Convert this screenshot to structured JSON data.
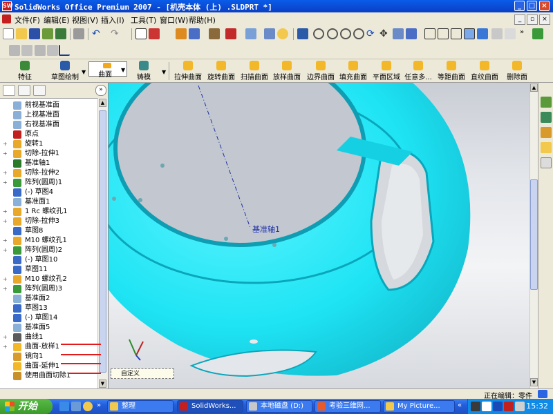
{
  "window": {
    "title": "SolidWorks Office Premium 2007 - [机壳本体 (上) .SLDPRT *]",
    "app_icon_text": "SW"
  },
  "menu": [
    "文件(F)",
    "编辑(E)",
    "视图(V)",
    "插入(I)",
    "工具(T)",
    "窗口(W)",
    "帮助(H)"
  ],
  "command_manager": {
    "left_items": [
      "特征",
      "草图绘制"
    ],
    "selector_label": "曲面",
    "mold_label": "铸模",
    "tools": [
      "拉伸曲面",
      "旋转曲面",
      "扫描曲面",
      "放样曲面",
      "边界曲面",
      "填充曲面",
      "平面区域",
      "任意多...",
      "等距曲面",
      "直纹曲面",
      "删除面"
    ]
  },
  "feature_tree": [
    {
      "label": "前视基准面",
      "expand": "",
      "icon": "plane"
    },
    {
      "label": "上视基准面",
      "expand": "",
      "icon": "plane"
    },
    {
      "label": "右视基准面",
      "expand": "",
      "icon": "plane"
    },
    {
      "label": "原点",
      "expand": "",
      "icon": "origin"
    },
    {
      "label": "旋转1",
      "expand": "+",
      "icon": "revolve"
    },
    {
      "label": "切除-拉伸1",
      "expand": "+",
      "icon": "cut"
    },
    {
      "label": "基准轴1",
      "expand": "",
      "icon": "axis"
    },
    {
      "label": "切除-拉伸2",
      "expand": "+",
      "icon": "cut"
    },
    {
      "label": "阵列(圆周)1",
      "expand": "+",
      "icon": "pattern"
    },
    {
      "label": "(-) 草图4",
      "expand": "",
      "icon": "sketch"
    },
    {
      "label": "基准面1",
      "expand": "",
      "icon": "plane"
    },
    {
      "label": "1 Rc 螺纹孔1",
      "expand": "+",
      "icon": "hole"
    },
    {
      "label": "切除-拉伸3",
      "expand": "+",
      "icon": "cut"
    },
    {
      "label": "草图8",
      "expand": "",
      "icon": "sketch"
    },
    {
      "label": "M10 螺纹孔1",
      "expand": "+",
      "icon": "hole"
    },
    {
      "label": "阵列(圆周)2",
      "expand": "+",
      "icon": "pattern"
    },
    {
      "label": "(-) 草图10",
      "expand": "",
      "icon": "sketch"
    },
    {
      "label": "草图11",
      "expand": "",
      "icon": "sketch"
    },
    {
      "label": "M10 螺纹孔2",
      "expand": "+",
      "icon": "hole"
    },
    {
      "label": "阵列(圆周)3",
      "expand": "+",
      "icon": "pattern"
    },
    {
      "label": "基准面2",
      "expand": "",
      "icon": "plane"
    },
    {
      "label": "草图13",
      "expand": "",
      "icon": "sketch"
    },
    {
      "label": "(-) 草图14",
      "expand": "",
      "icon": "sketch"
    },
    {
      "label": "基准面5",
      "expand": "",
      "icon": "plane"
    },
    {
      "label": "曲线1",
      "expand": "+",
      "icon": "curve"
    },
    {
      "label": "曲面-放样1",
      "expand": "+",
      "icon": "loft"
    },
    {
      "label": "镜向1",
      "expand": "",
      "icon": "mirror"
    },
    {
      "label": "曲面-延伸1",
      "expand": "",
      "icon": "extend"
    },
    {
      "label": "使用曲面切除1",
      "expand": "",
      "icon": "surfcut"
    }
  ],
  "viewport": {
    "axis_label": "基准轴1",
    "model_color": "#1ee4f4",
    "background_color": "#e2e5ea",
    "custom_tab": "自定义"
  },
  "status_bar": {
    "text": "正在编辑：零件"
  },
  "taskbar": {
    "start_label": "开始",
    "tasks": [
      "整理",
      "SolidWorks...",
      "本地磁盘 (D:)",
      "考验三维网...",
      "My Picture..."
    ],
    "clock": "15:32"
  },
  "colors": {
    "accent": "#0a5ce8",
    "annotation_red": "#e21a1a",
    "model": "#1ee4f4"
  }
}
